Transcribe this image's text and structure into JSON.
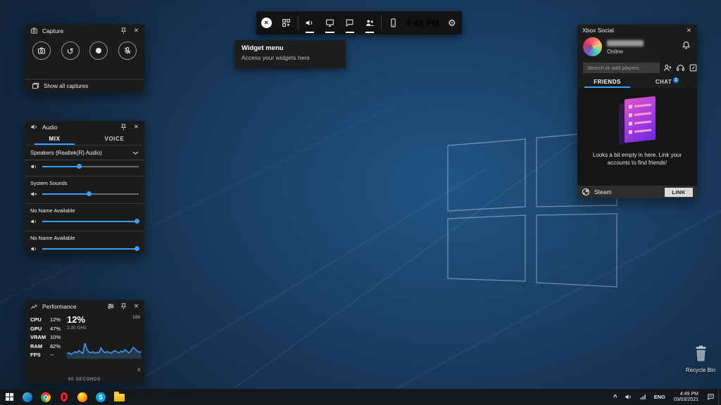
{
  "colors": {
    "accent": "#3b9dff",
    "badge": "#2e7cd6"
  },
  "gamebar": {
    "time": "4:49 PM",
    "tooltip": {
      "title": "Widget menu",
      "subtitle": "Access your widgets here"
    }
  },
  "capture": {
    "title": "Capture",
    "footer": "Show all captures"
  },
  "audio": {
    "title": "Audio",
    "tabs": [
      "MIX",
      "VOICE"
    ],
    "device": "Speakers (Realtek(R) Audio)",
    "device_volume": 38,
    "channels": [
      {
        "label": "System Sounds",
        "value": 48
      },
      {
        "label": "No Name Available",
        "value": 98
      },
      {
        "label": "No Name Available",
        "value": 98
      }
    ]
  },
  "performance": {
    "title": "Performance",
    "stats": [
      {
        "label": "CPU",
        "value": "12%"
      },
      {
        "label": "GPU",
        "value": "47%"
      },
      {
        "label": "VRAM",
        "value": "10%"
      },
      {
        "label": "RAM",
        "value": "82%"
      },
      {
        "label": "FPS",
        "value": "--"
      }
    ],
    "big_value": "12%",
    "frequency": "2.30 GHz",
    "axis_max": "100",
    "axis_min": "0",
    "caption": "60 SECONDS",
    "sparkline": [
      18,
      22,
      16,
      20,
      26,
      22,
      30,
      24,
      20,
      58,
      34,
      24,
      22,
      26,
      20,
      24,
      22,
      40,
      28,
      22,
      26,
      24,
      20,
      26,
      30,
      24,
      22,
      28,
      24,
      34,
      26,
      22,
      30,
      42,
      36,
      28,
      24,
      26
    ]
  },
  "social": {
    "title": "Xbox Social",
    "presence": "Online",
    "search_placeholder": "Search or add players",
    "tabs": [
      {
        "label": "FRIENDS"
      },
      {
        "label": "CHAT",
        "badge": "1"
      }
    ],
    "empty_message": "Looks a bit empty in here. Link your accounts to find friends!",
    "steam": "Steam",
    "link_button": "LINK"
  },
  "desktop": {
    "recycle_bin_label": "Recycle Bin"
  },
  "taskbar": {
    "language": "ENG",
    "time": "4:49 PM",
    "date": "03/03/2021",
    "apps": [
      "edge",
      "chrome",
      "opera",
      "firefox",
      "skype",
      "file-explorer"
    ]
  }
}
